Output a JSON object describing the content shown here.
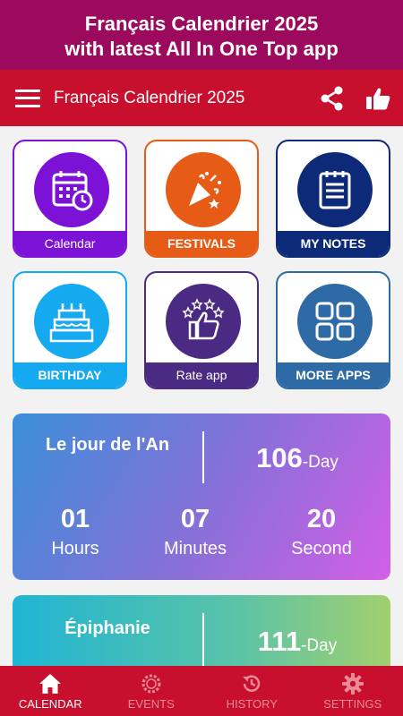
{
  "banner": {
    "line1": "Français Calendrier 2025",
    "line2": "with latest All In One Top app"
  },
  "appbar": {
    "title": "Français Calendrier 2025"
  },
  "tiles": [
    {
      "label": "Calendar",
      "color": "#7b12d6",
      "icon": "calendar-icon"
    },
    {
      "label": "FESTIVALS",
      "color": "#e65c16",
      "icon": "party-popper-icon"
    },
    {
      "label": "MY NOTES",
      "color": "#0d2a78",
      "icon": "notes-icon"
    },
    {
      "label": "BIRTHDAY",
      "color": "#15a9f0",
      "icon": "birthday-cake-icon"
    },
    {
      "label": "Rate app",
      "color": "#4a2a82",
      "icon": "rate-thumbs-up-icon"
    },
    {
      "label": "MORE APPS",
      "color": "#2e6aa6",
      "icon": "grid-apps-icon"
    }
  ],
  "events": [
    {
      "name": "Le jour de l'An",
      "days": "106",
      "days_unit": "-Day",
      "hours": "01",
      "hours_label": "Hours",
      "minutes": "07",
      "minutes_label": "Minutes",
      "seconds": "20",
      "seconds_label": "Second"
    },
    {
      "name": "Épiphanie",
      "days": "111",
      "days_unit": "-Day"
    }
  ],
  "bottom_nav": [
    {
      "label": "CALENDAR",
      "icon": "home-icon",
      "active": true
    },
    {
      "label": "EVENTS",
      "icon": "wreath-icon",
      "active": false
    },
    {
      "label": "HISTORY",
      "icon": "history-icon",
      "active": false
    },
    {
      "label": "SETTINGS",
      "icon": "gear-icon",
      "active": false
    }
  ]
}
